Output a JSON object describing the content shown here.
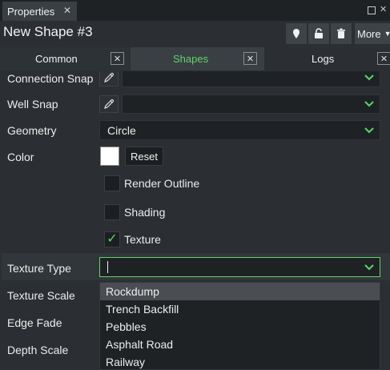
{
  "window": {
    "tab_label": "Properties",
    "tab_close_icon": "close-icon"
  },
  "header": {
    "title": "New Shape #3",
    "buttons": [
      "pin-icon",
      "lock-icon",
      "trash-icon"
    ],
    "more_label": "More"
  },
  "subtabs": [
    {
      "label": "Common",
      "active": false
    },
    {
      "label": "Shapes",
      "active": true
    },
    {
      "label": "Logs",
      "active": false
    }
  ],
  "properties": {
    "connection_snap": {
      "label": "Connection Snap",
      "value": ""
    },
    "well_snap": {
      "label": "Well Snap",
      "value": ""
    },
    "geometry": {
      "label": "Geometry",
      "value": "Circle"
    },
    "color": {
      "label": "Color",
      "value": "#ffffff",
      "reset_label": "Reset"
    },
    "render_outline": {
      "label": "Render Outline",
      "checked": false
    },
    "shading": {
      "label": "Shading",
      "checked": false
    },
    "texture": {
      "label": "Texture",
      "checked": true
    },
    "texture_type": {
      "label": "Texture Type",
      "value": ""
    },
    "texture_scale": {
      "label": "Texture Scale"
    },
    "edge_fade": {
      "label": "Edge Fade"
    },
    "depth_scale": {
      "label": "Depth Scale"
    }
  },
  "texture_options": [
    "Rockdump",
    "Trench Backfill",
    "Pebbles",
    "Asphalt Road",
    "Railway"
  ],
  "texture_highlighted": "Rockdump",
  "colors": {
    "accent": "#5fd36a",
    "panel": "#2b2f33",
    "field": "#1f2225"
  }
}
